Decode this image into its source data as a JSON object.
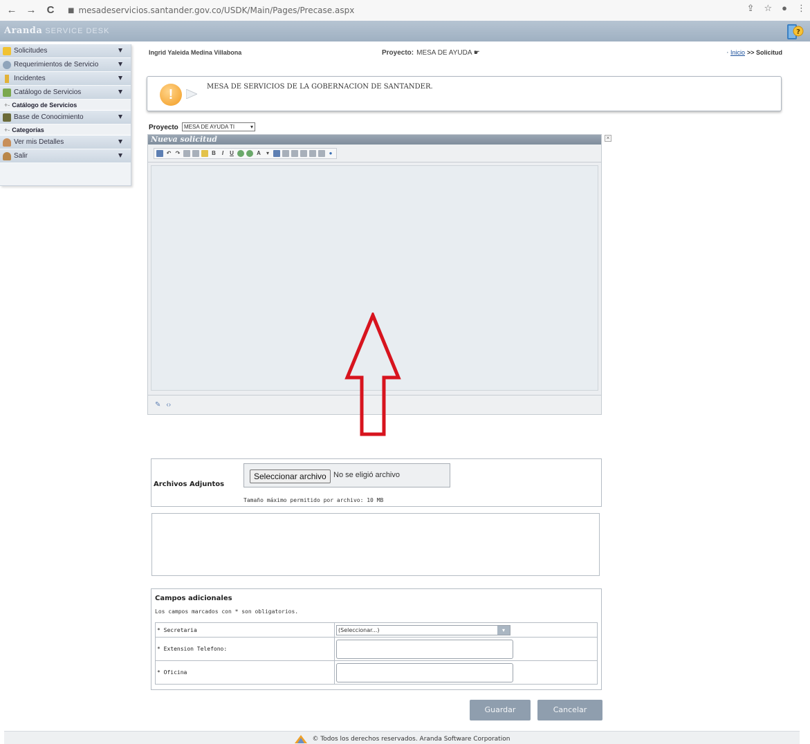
{
  "browser": {
    "back": "←",
    "forward": "→",
    "reload": "C",
    "url": "mesadeservicios.santander.gov.co/USDK/Main/Pages/Precase.aspx"
  },
  "header": {
    "brand": "Aranda",
    "brand_sub": "SERVICE DESK"
  },
  "sidebar": {
    "items": [
      {
        "label": "Solicitudes"
      },
      {
        "label": "Requerimientos de Servicio"
      },
      {
        "label": "Incidentes"
      },
      {
        "label": "Catálogo de Servicios"
      },
      {
        "label": "Catálogo de Servicios",
        "sub": true
      },
      {
        "label": "Base de Conocimiento"
      },
      {
        "label": "Categorías",
        "sub": true
      },
      {
        "label": "Ver mis Detalles"
      },
      {
        "label": "Salir"
      }
    ]
  },
  "info": {
    "user": "Ingrid Yaleida Medina Villabona",
    "project_label": "Proyecto:",
    "project_value": "MESA DE AYUDA",
    "crumb_link": "Inicio",
    "crumb_rest": ">> Solicitud"
  },
  "message": {
    "text": "MESA DE SERVICIOS DE LA GOBERNACION DE SANTANDER."
  },
  "project_select": {
    "label": "Proyecto",
    "value": "MESA DE AYUDA TI"
  },
  "editor": {
    "title": "Nueva solicitud"
  },
  "attachments": {
    "label": "Archivos Adjuntos",
    "button": "Seleccionar archivo",
    "status": "No se eligió archivo",
    "max_size": "Tamaño máximo permitido por archivo: 10 MB"
  },
  "campos": {
    "title": "Campos adicionales",
    "note": "Los campos marcados con * son obligatorios.",
    "fields": [
      {
        "label": "* Secretaria",
        "value": "(Seleccionar...)"
      },
      {
        "label": "* Extension Telefono:"
      },
      {
        "label": "* Oficina"
      }
    ]
  },
  "buttons": {
    "save": "Guardar",
    "cancel": "Cancelar"
  },
  "footer": {
    "text": "© Todos los derechos reservados. Aranda Software Corporation"
  },
  "colors": {
    "accent": "#8f9eae",
    "header": "#a9b8c8",
    "arrow": "#d7141e"
  }
}
